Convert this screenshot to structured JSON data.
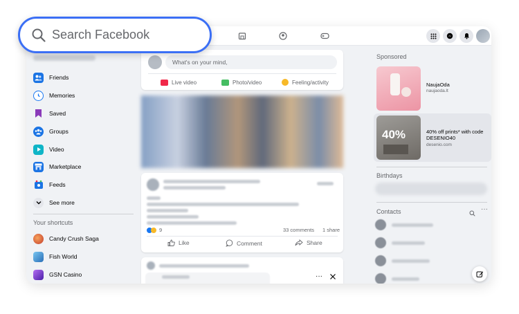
{
  "search": {
    "placeholder": "Search Facebook"
  },
  "composer": {
    "prompt": "What's on your mind,",
    "actions": [
      {
        "label": "Live video",
        "color": "#f02849"
      },
      {
        "label": "Photo/video",
        "color": "#45bd62"
      },
      {
        "label": "Feeling/activity",
        "color": "#f7b928"
      }
    ]
  },
  "sidebar": {
    "items": [
      {
        "label": "Friends",
        "icon": "friends-icon",
        "color": "#1b74e4"
      },
      {
        "label": "Memories",
        "icon": "memories-icon",
        "color": "#1877f2"
      },
      {
        "label": "Saved",
        "icon": "saved-icon",
        "color": "#8a3ab9"
      },
      {
        "label": "Groups",
        "icon": "groups-icon",
        "color": "#1b74e4"
      },
      {
        "label": "Video",
        "icon": "video-icon",
        "color": "#0fb5c7"
      },
      {
        "label": "Marketplace",
        "icon": "marketplace-icon",
        "color": "#1b74e4"
      },
      {
        "label": "Feeds",
        "icon": "feeds-icon",
        "color": "#1b74e4"
      },
      {
        "label": "See more",
        "icon": "chevron-down-icon",
        "color": "#e4e6eb"
      }
    ],
    "shortcuts_heading": "Your shortcuts",
    "shortcuts": [
      {
        "label": "Candy Crush Saga",
        "icon": "candy-crush-icon",
        "color": "#e0493a"
      },
      {
        "label": "Fish World",
        "icon": "fish-world-icon",
        "color": "#3a8fd6"
      },
      {
        "label": "GSN Casino",
        "icon": "gsn-casino-icon",
        "color": "#6a3bd1"
      }
    ]
  },
  "post": {
    "reactions_count": "9",
    "comments": "33 comments",
    "shares": "1 share",
    "like": "Like",
    "comment": "Comment",
    "share": "Share"
  },
  "right": {
    "sponsored_heading": "Sponsored",
    "ads": [
      {
        "title": "NaujaOda",
        "url": "naujaoda.lt"
      },
      {
        "title": "40% off prints* with code DESENIO40",
        "url": "desenio.com",
        "thumb_text": "40%"
      }
    ],
    "birthdays_heading": "Birthdays",
    "contacts_heading": "Contacts"
  },
  "colors": {
    "accent": "#1877f2",
    "highlight_ring": "#3b6ff5"
  }
}
